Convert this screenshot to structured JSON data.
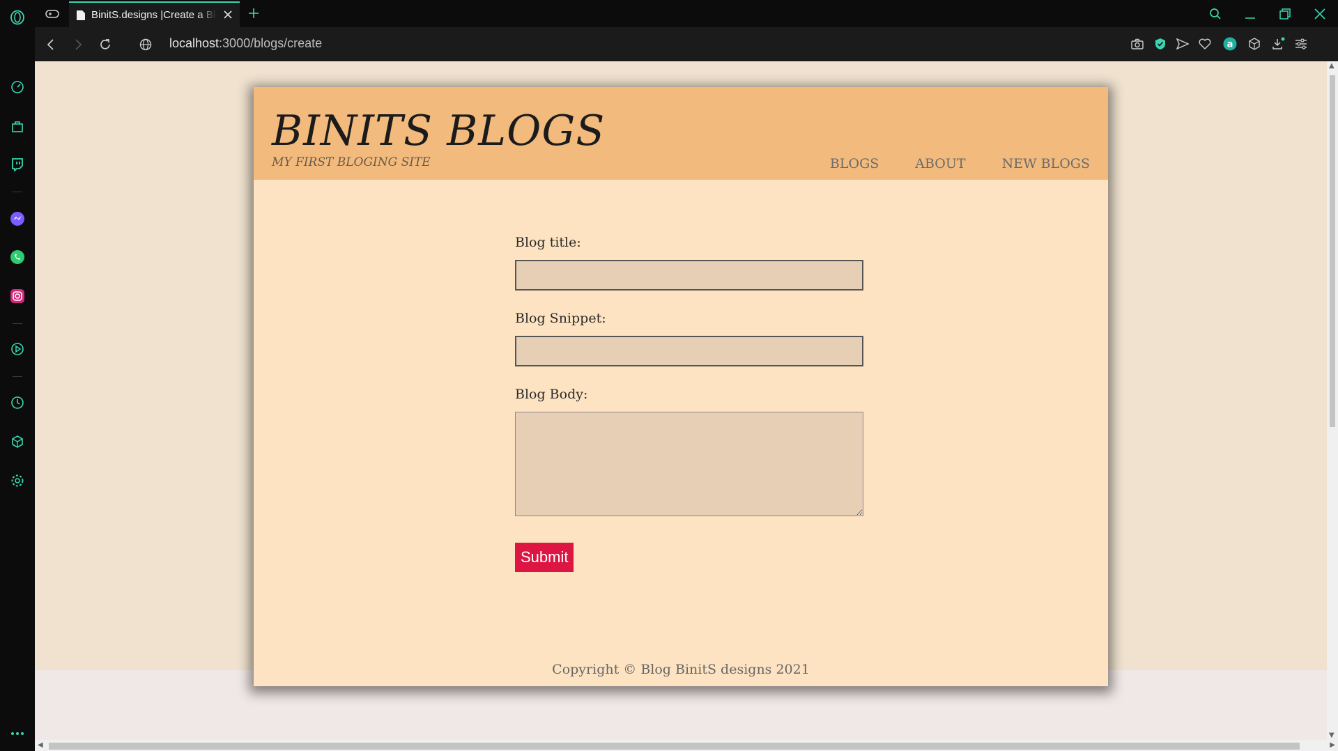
{
  "browser": {
    "tab_title": "BinitS.designs |Create a Blog",
    "url_host": "localhost",
    "url_path": ":3000/blogs/create",
    "accent_color": "#3ad6b0"
  },
  "sidebar": {
    "icons": [
      "opera-logo-icon",
      "speed-dial-icon",
      "shopping-icon",
      "twitch-icon",
      "messenger-icon",
      "whatsapp-icon",
      "instagram-icon",
      "player-icon",
      "history-icon",
      "extensions-icon",
      "settings-icon",
      "more-icon"
    ]
  },
  "site": {
    "brand": "BINITS BLOGS",
    "tagline": "MY FIRST BLOGING SITE",
    "nav": [
      "BLOGS",
      "ABOUT",
      "NEW BLOGS"
    ],
    "colors": {
      "header": "#f2ba7c",
      "body": "#fde3c1",
      "submit": "#dc1542"
    }
  },
  "form": {
    "title_label": "Blog title:",
    "title_value": "",
    "snippet_label": "Blog Snippet:",
    "snippet_value": "",
    "body_label": "Blog Body:",
    "body_value": "",
    "submit_label": "Submit"
  },
  "footer": {
    "copyright": "Copyright © Blog BinitS designs 2021"
  }
}
